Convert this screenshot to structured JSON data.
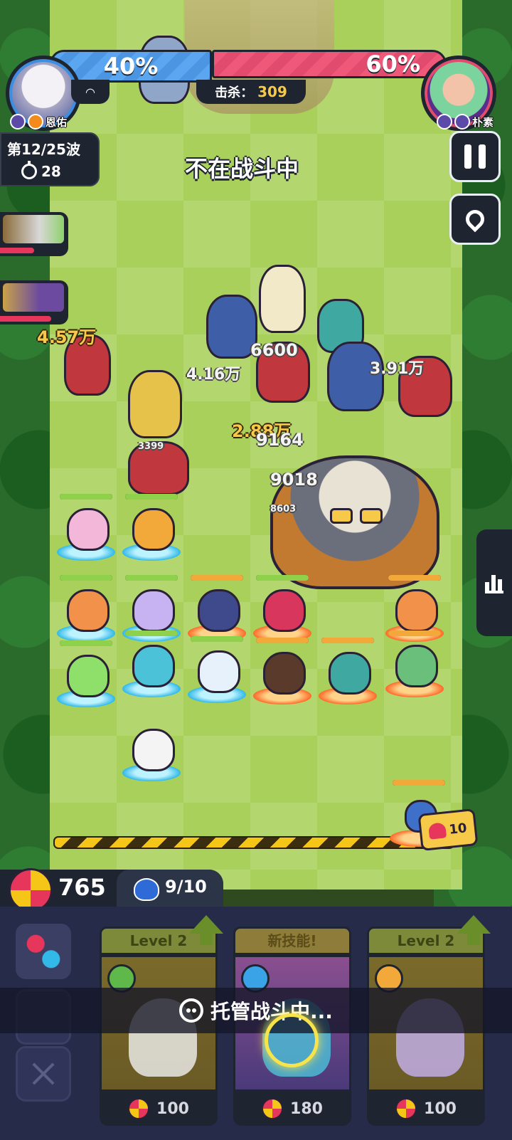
{
  "hud": {
    "player_left": {
      "name": "恩佑",
      "percent": "40%"
    },
    "player_right": {
      "name": "朴素",
      "percent": "60%"
    },
    "kills_label": "击杀：",
    "kills_value": "309",
    "wave": "第12/25波",
    "timer": "28",
    "status": "不在战斗中"
  },
  "damage_numbers": [
    "4.57万",
    "4.16万",
    "6600",
    "3.91万",
    "2.88万",
    "9164",
    "9018",
    "8603",
    "3399"
  ],
  "resources": {
    "coins": "765",
    "population": "9/10"
  },
  "heart_tag": "10",
  "shop": {
    "cards": [
      {
        "tag": "Level 2",
        "price": "100",
        "element": "nature"
      },
      {
        "tag": "新技能!",
        "price": "180",
        "element": "water"
      },
      {
        "tag": "Level 2",
        "price": "100",
        "element": "lightning"
      }
    ],
    "auto_battle": "托管战斗中..."
  },
  "colors": {
    "team_blue": "#4b95e3",
    "team_red": "#e14c6e",
    "gold": "#f7c948",
    "panel": "#1e2430"
  }
}
